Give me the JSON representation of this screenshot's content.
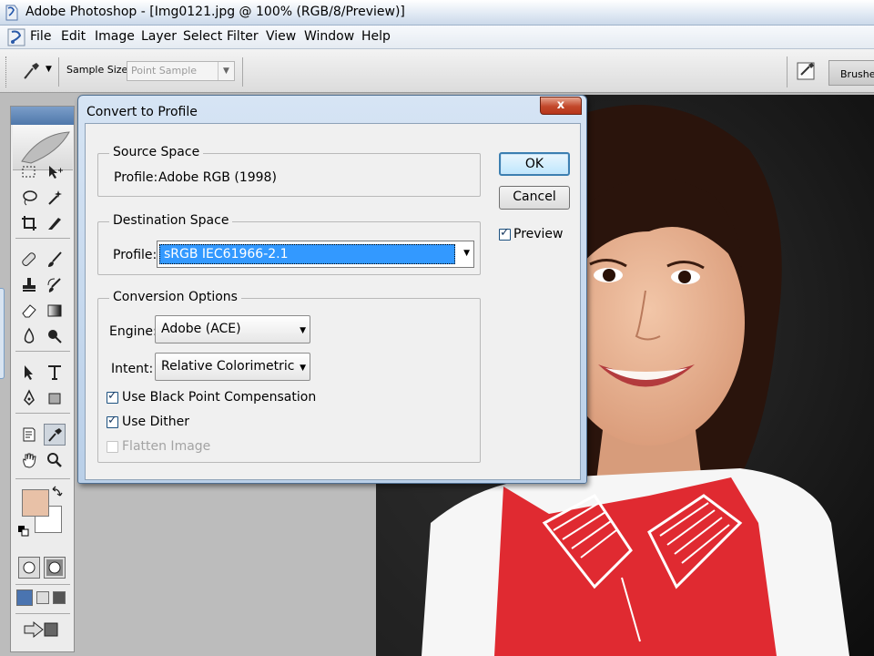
{
  "window": {
    "title": "Adobe Photoshop - [Img0121.jpg @ 100% (RGB/8/Preview)]"
  },
  "menu": {
    "items": [
      "File",
      "Edit",
      "Image",
      "Layer",
      "Select",
      "Filter",
      "View",
      "Window",
      "Help"
    ]
  },
  "options_bar": {
    "sample_size_label": "Sample Size:",
    "sample_size_value": "Point Sample",
    "panel_tab": "Brushes"
  },
  "toolbox": {
    "foreground_color": "#e8c1a7",
    "background_color": "#ffffff"
  },
  "dialog": {
    "title": "Convert to Profile",
    "close_label": "x",
    "source_space": {
      "legend": "Source Space",
      "profile_label": "Profile:",
      "profile_value": "Adobe RGB (1998)"
    },
    "destination_space": {
      "legend": "Destination Space",
      "profile_label": "Profile:",
      "profile_value": "sRGB IEC61966-2.1"
    },
    "conversion_options": {
      "legend": "Conversion Options",
      "engine_label": "Engine:",
      "engine_value": "Adobe (ACE)",
      "intent_label": "Intent:",
      "intent_value": "Relative Colorimetric",
      "black_point_label": "Use Black Point Compensation",
      "black_point_checked": true,
      "dither_label": "Use Dither",
      "dither_checked": true,
      "flatten_label": "Flatten Image",
      "flatten_checked": false,
      "flatten_enabled": false
    },
    "ok_label": "OK",
    "cancel_label": "Cancel",
    "preview_label": "Preview",
    "preview_checked": true
  },
  "colors": {
    "title_bar_top": "#ffffff",
    "selection_blue": "#3399ff",
    "close_button_red": "#c2472a",
    "shirt_red": "#e02a31"
  }
}
